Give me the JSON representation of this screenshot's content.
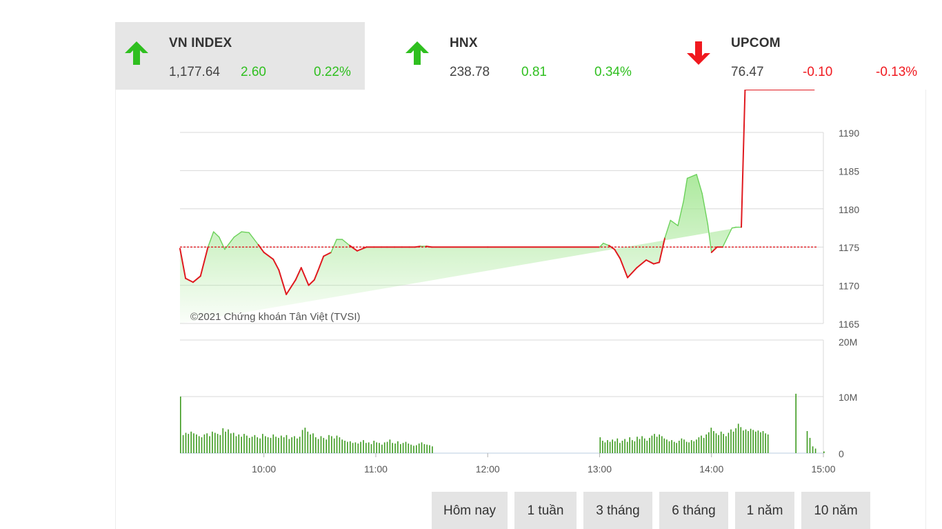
{
  "indices": [
    {
      "name": "VN INDEX",
      "value": "1,177.64",
      "change": "2.60",
      "percent": "0.22%",
      "direction": "up",
      "active": true
    },
    {
      "name": "HNX",
      "value": "238.78",
      "change": "0.81",
      "percent": "0.34%",
      "direction": "up",
      "active": false
    },
    {
      "name": "UPCOM",
      "value": "76.47",
      "change": "-0.10",
      "percent": "-0.13%",
      "direction": "down",
      "active": false
    }
  ],
  "colors": {
    "up": "#2fbf1f",
    "down": "#f0191f",
    "reference_line": "#e0191f",
    "volume_bar": "#3c9a1e",
    "area_fill": "#a8e898"
  },
  "icons": {
    "up": "arrow-up-icon",
    "down": "arrow-down-icon"
  },
  "chart_data": [
    {
      "type": "area",
      "watermark": "©2021 Chứng khoán Tân Việt (TVSI)",
      "x_tick_labels": [
        "10:00",
        "11:00",
        "12:00",
        "13:00",
        "14:00",
        "15:00"
      ],
      "y_tick_labels": [
        "1190",
        "1185",
        "1180",
        "1175",
        "1170",
        "1165"
      ],
      "ylim": [
        1165,
        1190
      ],
      "xlim": [
        "9:15",
        "15:00"
      ],
      "reference": 1175.0,
      "grid": true,
      "x": [
        "9:15",
        "9:18",
        "9:22",
        "9:26",
        "9:30",
        "9:33",
        "9:36",
        "9:39",
        "9:44",
        "9:48",
        "9:52",
        "9:57",
        "10:00",
        "10:05",
        "10:08",
        "10:12",
        "10:17",
        "10:20",
        "10:24",
        "10:27",
        "10:29",
        "10:32",
        "10:36",
        "10:39",
        "10:42",
        "10:46",
        "10:50",
        "10:55",
        "10:59",
        "11:03",
        "11:06",
        "11:10",
        "11:14",
        "11:18",
        "11:21",
        "11:24",
        "11:27",
        "11:30",
        "12:00",
        "13:00",
        "13:02",
        "13:05",
        "13:08",
        "13:11",
        "13:15",
        "13:20",
        "13:25",
        "13:29",
        "13:32",
        "13:35",
        "13:38",
        "13:42",
        "13:45",
        "13:47",
        "13:52",
        "13:55",
        "13:58",
        "14:00",
        "14:03",
        "14:06",
        "14:08",
        "14:11",
        "14:13",
        "14:16",
        "14:18",
        "14:20",
        "14:22",
        "14:24",
        "14:26",
        "14:28",
        "14:30",
        "14:32",
        "14:34",
        "14:37",
        "14:40",
        "14:43",
        "14:48",
        "14:55"
      ],
      "values": [
        1174.8,
        1170.9,
        1170.4,
        1171.2,
        1175.0,
        1177.0,
        1176.3,
        1174.7,
        1176.3,
        1177.0,
        1176.9,
        1175.3,
        1174.3,
        1173.4,
        1172.0,
        1168.8,
        1170.7,
        1172.3,
        1170.0,
        1170.7,
        1171.9,
        1173.8,
        1174.3,
        1176.0,
        1176.0,
        1175.2,
        1174.5,
        1175.0,
        1175.0,
        1175.0,
        1175.0,
        1175.0,
        1175.0,
        1175.0,
        1175.0,
        1175.1,
        1175.1,
        1175.0,
        1175.0,
        1175.0,
        1175.5,
        1175.2,
        1174.7,
        1173.5,
        1171.0,
        1172.3,
        1173.3,
        1172.8,
        1173.0,
        1176.2,
        1178.5,
        1177.8,
        1181.0,
        1184.0,
        1184.5,
        1182.0,
        1178.0,
        1174.3,
        1175.0,
        1175.0,
        1176.0,
        1177.5,
        1177.6,
        1177.6
      ],
      "ylabel": ""
    },
    {
      "type": "bar",
      "y_tick_labels": [
        "20M",
        "10M",
        "0"
      ],
      "ylim": [
        0,
        20000000
      ],
      "x_tick_labels": [
        "10:00",
        "11:00",
        "12:00",
        "13:00",
        "14:00",
        "15:00"
      ],
      "sessions": [
        {
          "from": "9:15",
          "to": "11:30",
          "base": [
            10000000,
            3200000,
            3600000,
            3400000,
            3800000,
            3500000,
            3300000,
            3000000,
            2800000,
            3300000,
            3500000,
            3000000,
            3800000,
            3600000,
            3400000,
            3200000,
            4400000,
            3800000,
            4200000,
            3500000,
            3600000,
            3000000,
            3300000,
            2900000,
            3400000,
            3100000,
            2700000,
            2900000,
            3200000,
            2800000,
            2600000,
            3400000,
            3000000,
            2800000,
            2700000,
            3300000,
            2900000,
            2700000,
            3100000,
            2800000,
            3200000,
            2500000,
            2800000,
            3000000,
            2600000,
            2900000,
            4100000,
            4500000,
            3800000,
            3300000,
            3500000,
            2800000,
            2500000,
            3000000,
            2700000,
            2400000,
            3200000,
            3000000,
            2600000,
            3100000,
            2800000,
            2400000,
            2200000,
            2000000,
            2100000,
            1800000,
            1900000,
            1700000,
            2000000,
            2300000,
            1800000,
            1900000,
            1600000,
            2200000,
            1900000,
            1800000,
            1500000,
            1900000,
            2000000,
            2400000,
            1800000,
            1700000,
            2100000,
            1600000,
            1800000,
            2000000,
            1700000,
            1500000,
            1300000,
            1400000,
            1700000,
            1900000,
            1600000,
            1500000,
            1400000,
            1200000
          ]
        },
        {
          "from": "13:00",
          "to": "14:30",
          "base": [
            2800000,
            2200000,
            1900000,
            2300000,
            2000000,
            2400000,
            2100000,
            2600000,
            1800000,
            2200000,
            2500000,
            2000000,
            2800000,
            2300000,
            2100000,
            2900000,
            2500000,
            3000000,
            2600000,
            2200000,
            2700000,
            3100000,
            3400000,
            2900000,
            3300000,
            3000000,
            2600000,
            2400000,
            2100000,
            2300000,
            2000000,
            1800000,
            2200000,
            2600000,
            2400000,
            2000000,
            1900000,
            2300000,
            2100000,
            2400000,
            2800000,
            3100000,
            2700000,
            3300000,
            3700000,
            4500000,
            3900000,
            3500000,
            3200000,
            3800000,
            3400000,
            3000000,
            3600000,
            4200000,
            3800000,
            4400000,
            5200000,
            4600000,
            4000000,
            4200000,
            3900000,
            4300000,
            4100000,
            3800000,
            4000000,
            3700000,
            3900000,
            3500000,
            3300000
          ]
        },
        {
          "from": "14:45",
          "to": "15:00",
          "base": [
            10500000,
            0,
            0,
            0,
            3900000,
            2700000,
            1200000,
            800000,
            0,
            0,
            300000
          ]
        }
      ]
    }
  ],
  "period_buttons": [
    {
      "label": "Hôm nay"
    },
    {
      "label": "1 tuần"
    },
    {
      "label": "3 tháng"
    },
    {
      "label": "6 tháng"
    },
    {
      "label": "1 năm"
    },
    {
      "label": "10 năm"
    }
  ]
}
